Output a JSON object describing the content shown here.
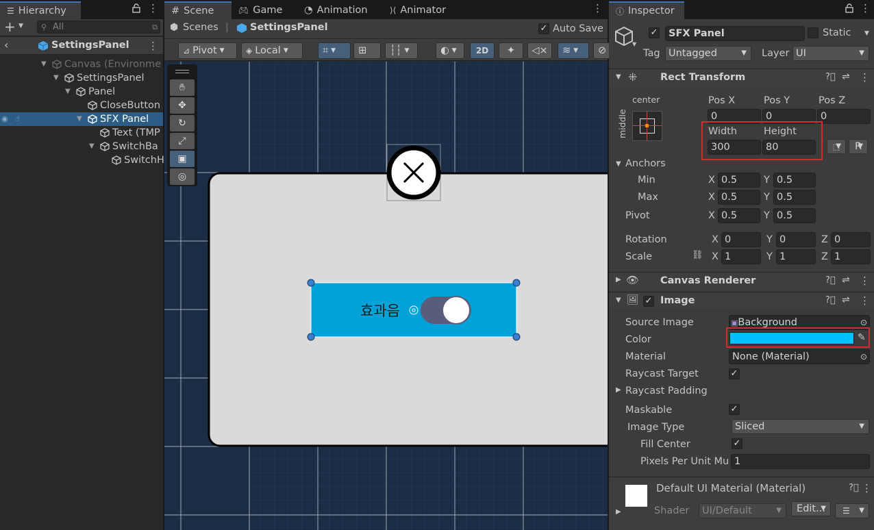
{
  "hierarchy": {
    "tab": "Hierarchy",
    "search_placeholder": "All",
    "header": "SettingsPanel",
    "items": [
      {
        "label": "Canvas (Environme",
        "muted": true
      },
      {
        "label": "SettingsPanel"
      },
      {
        "label": "Panel"
      },
      {
        "label": "CloseButton"
      },
      {
        "label": "SFX Panel",
        "selected": true
      },
      {
        "label": "Text (TMP"
      },
      {
        "label": "SwitchBa"
      },
      {
        "label": "SwitchH"
      }
    ]
  },
  "scene": {
    "tabs": [
      "Scene",
      "Game",
      "Animation",
      "Animator"
    ],
    "breadcrumb_root": "Scenes",
    "breadcrumb_current": "SettingsPanel",
    "auto_save_label": "Auto Save",
    "auto_save_checked": true,
    "pivot_label": "Pivot",
    "local_label": "Local",
    "mode_2d": "2D",
    "sfx_label": "효과음",
    "selection_color": "#00a2d8"
  },
  "inspector": {
    "tab": "Inspector",
    "object_name": "SFX Panel",
    "static_label": "Static",
    "tag_label": "Tag",
    "tag_value": "Untagged",
    "layer_label": "Layer",
    "layer_value": "UI",
    "rect_transform": {
      "title": "Rect Transform",
      "anchor_preset_h": "center",
      "anchor_preset_v": "middle",
      "pos_x_label": "Pos X",
      "pos_x": "0",
      "pos_y_label": "Pos Y",
      "pos_y": "0",
      "pos_z_label": "Pos Z",
      "pos_z": "0",
      "width_label": "Width",
      "width": "300",
      "height_label": "Height",
      "height": "80",
      "anchors_label": "Anchors",
      "min_label": "Min",
      "min_x": "0.5",
      "min_y": "0.5",
      "max_label": "Max",
      "max_x": "0.5",
      "max_y": "0.5",
      "pivot_label": "Pivot",
      "pivot_x": "0.5",
      "pivot_y": "0.5",
      "rotation_label": "Rotation",
      "rot_x": "0",
      "rot_y": "0",
      "rot_z": "0",
      "scale_label": "Scale",
      "scale_x": "1",
      "scale_y": "1",
      "scale_z": "1",
      "x": "X",
      "y": "Y",
      "z": "Z",
      "r_btn": "R"
    },
    "canvas_renderer": {
      "title": "Canvas Renderer"
    },
    "image": {
      "title": "Image",
      "source_image_label": "Source Image",
      "source_image_value": "Background",
      "color_label": "Color",
      "color_value": "#00bfff",
      "material_label": "Material",
      "material_value": "None (Material)",
      "raycast_target_label": "Raycast Target",
      "raycast_padding_label": "Raycast Padding",
      "maskable_label": "Maskable",
      "image_type_label": "Image Type",
      "image_type_value": "Sliced",
      "fill_center_label": "Fill Center",
      "ppu_label": "Pixels Per Unit Mu",
      "ppu_value": "1"
    },
    "material": {
      "title": "Default UI Material (Material)",
      "shader_label": "Shader",
      "shader_value": "UI/Default",
      "edit_label": "Edit..."
    }
  }
}
